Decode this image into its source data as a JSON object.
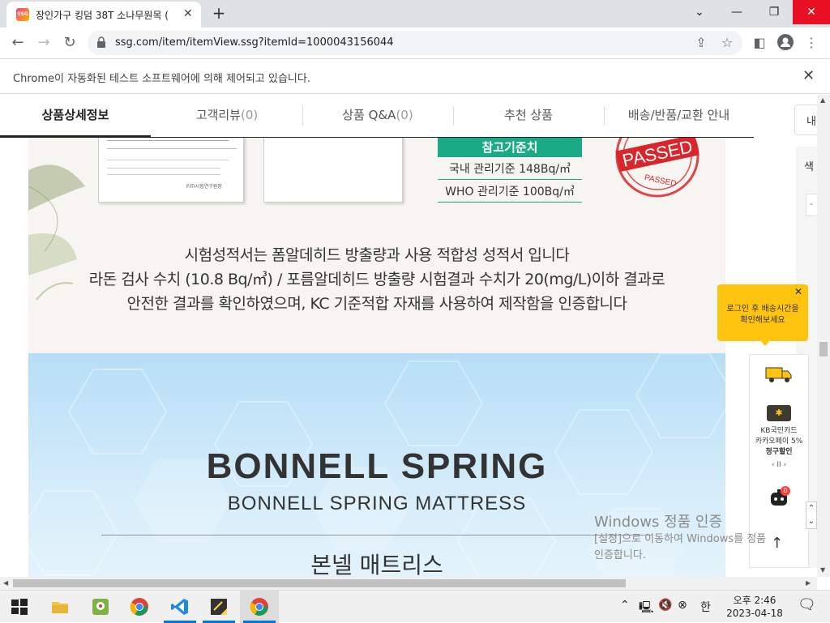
{
  "browser": {
    "tab_title": "장인가구 킹덤 38T 소나무원목 (",
    "favicon_text": "SSG",
    "url": "ssg.com/item/itemView.ssg?itemId=1000043156044",
    "infobar_message": "Chrome이 자동화된 테스트 소프트웨어에 의해 제어되고 있습니다."
  },
  "product_tabs": [
    {
      "label": "상품상세정보",
      "active": true
    },
    {
      "label": "고객리뷰",
      "count": "(0)",
      "active": false
    },
    {
      "label": "상품 Q&A",
      "count": "(0)",
      "active": false
    },
    {
      "label": "추천 상품",
      "active": false
    },
    {
      "label": "배송/반품/교환 안내",
      "active": false
    }
  ],
  "right_cut": {
    "box_text": "내",
    "side_text": "색"
  },
  "certificate": {
    "lab_name": "FITI시험연구원장",
    "reference_title": "참고기준치",
    "reference_rows": [
      "국내 관리기준 148Bq/㎥",
      "WHO 관리기준 100Bq/㎥"
    ],
    "stamp_text": "PASSED",
    "stamp_small": "PASSED",
    "description": [
      "시험성적서는 폼알데히드 방출량과 사용 적합성 성적서 입니다",
      "라돈 검사 수치 (10.8 Bq/㎥) / 포름알데히드 방출량 시험결과 수치가 20(mg/L)이하 결과로",
      "안전한 결과를 확인하였으며, KC 기준적합 자재를 사용하여 제작함을 인증합니다"
    ]
  },
  "bonnell": {
    "title": "BONNELL SPRING",
    "subtitle": "BONNELL SPRING MATTRESS",
    "korean": "본넬 매트리스"
  },
  "tooltip": {
    "line1": "로그인 후 배송시간을",
    "line2": "확인해보세요"
  },
  "side_panel": {
    "card_line1": "KB국민카드",
    "card_line2": "카카오페이 5%",
    "card_line3": "청구할인",
    "pager": "‹ II ›",
    "badge": "0"
  },
  "watermark": {
    "line1": "Windows 정품 인증",
    "line2": "[설정]으로 이동하여 Windows를 정품",
    "line3": "인증합니다."
  },
  "taskbar": {
    "time": "오후 2:46",
    "date": "2023-04-18",
    "ime": "한"
  },
  "colors": {
    "accent_green": "#1aab86",
    "stamp_red": "#d9252b",
    "tooltip_yellow": "#ffc410"
  }
}
